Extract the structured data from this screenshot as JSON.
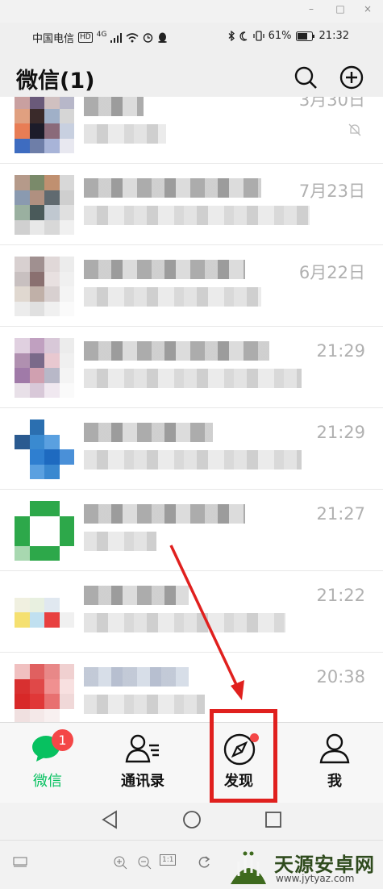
{
  "window": {
    "minimize": "–",
    "maximize": "□",
    "close": "×"
  },
  "status_bar": {
    "carrier": "中国电信",
    "hd": "HD",
    "network": "4G",
    "battery": "61%",
    "time": "21:32"
  },
  "header": {
    "title": "微信(1)"
  },
  "chats": [
    {
      "time": "3月30日",
      "muted": true
    },
    {
      "time": "7月23日"
    },
    {
      "time": "6月22日"
    },
    {
      "time": "21:29"
    },
    {
      "time": "21:29"
    },
    {
      "time": "21:27"
    },
    {
      "time": "21:22"
    },
    {
      "time": "20:38"
    }
  ],
  "tabs": [
    {
      "label": "微信",
      "badge": "1",
      "icon": "chat-icon",
      "active": true
    },
    {
      "label": "通讯录",
      "icon": "contacts-icon"
    },
    {
      "label": "发现",
      "icon": "compass-icon",
      "red_dot": true
    },
    {
      "label": "我",
      "icon": "person-icon"
    }
  ],
  "toolbar": {
    "fit": "1:1"
  },
  "watermark": {
    "name": "天源安卓网",
    "url": "www.jytyaz.com"
  },
  "colors": {
    "accent_green": "#07c160",
    "badge_red": "#f44747",
    "annotation_red": "#e0201e"
  }
}
